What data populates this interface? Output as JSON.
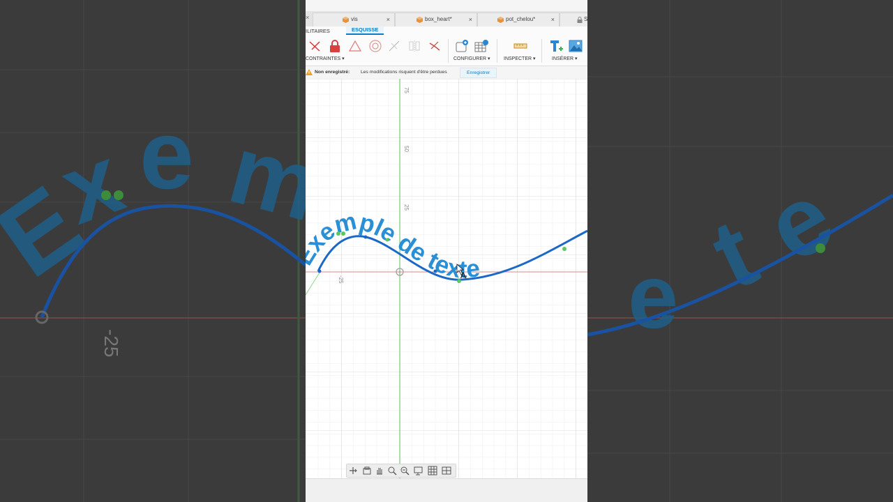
{
  "tabs": [
    {
      "name": "vis",
      "close": "×"
    },
    {
      "name": "box_heart*",
      "close": "×"
    },
    {
      "name": "pot_chelou*",
      "close": "×"
    },
    {
      "name": "S"
    }
  ],
  "tab_scroll_left": "×",
  "ribbon_tabs": {
    "utilities": "ILITAIRES",
    "sketch": "ESQUISSE"
  },
  "tool_groups": {
    "constraints": "CONTRAINTES ▾",
    "configure": "CONFIGURER ▾",
    "inspect": "INSPECTER ▾",
    "insert": "INSÉRER ▾"
  },
  "notice": {
    "status": "Non enregistré:",
    "message": "Les modifications risquent d'être perdues",
    "save": "Enregistrer"
  },
  "axis_ticks": {
    "y75": "75",
    "y50": "50",
    "y25": "25",
    "x_neg25": "-25"
  },
  "sketch_text": "Exemple de texte",
  "cursor_label": "A",
  "colors": {
    "accent": "#0a7bc4",
    "curve": "#1b68c6",
    "text": "#2b8fd6",
    "axis_green": "#5ac85a",
    "axis_red": "#d98a8a"
  },
  "nav_icons": [
    "orbit-icon",
    "look-at-icon",
    "pan-icon",
    "zoom-window-icon",
    "zoom-icon",
    "display-settings-icon",
    "grid-icon",
    "viewports-icon"
  ]
}
